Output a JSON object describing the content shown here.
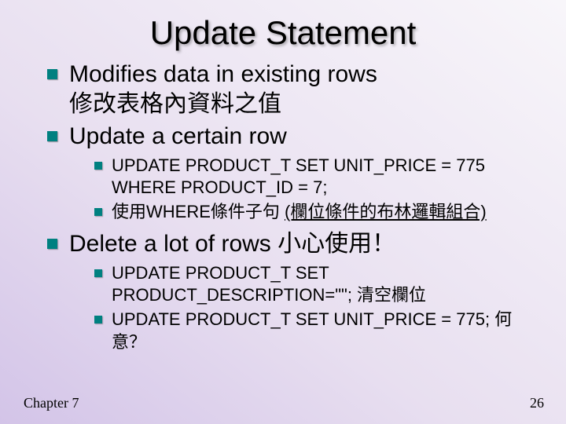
{
  "title": "Update Statement",
  "bullets": [
    {
      "line1": "Modifies data in existing rows",
      "line2": "修改表格內資料之值"
    },
    {
      "line1": "Update a certain row",
      "sub": [
        {
          "text": "UPDATE PRODUCT_T SET UNIT_PRICE = 775 WHERE PRODUCT_ID = 7;"
        },
        {
          "prefix": "使用WHERE條件子句 ",
          "underlined": "(欄位條件的布林邏輯組合)"
        }
      ]
    },
    {
      "line1": "Delete a lot of rows 小心使用！",
      "sub": [
        {
          "text": "UPDATE PRODUCT_T SET PRODUCT_DESCRIPTION=\"\"; 清空欄位"
        },
        {
          "text": "UPDATE PRODUCT_T SET UNIT_PRICE = 775;  何意？"
        }
      ]
    }
  ],
  "footer": {
    "left": "Chapter 7",
    "right": "26"
  }
}
